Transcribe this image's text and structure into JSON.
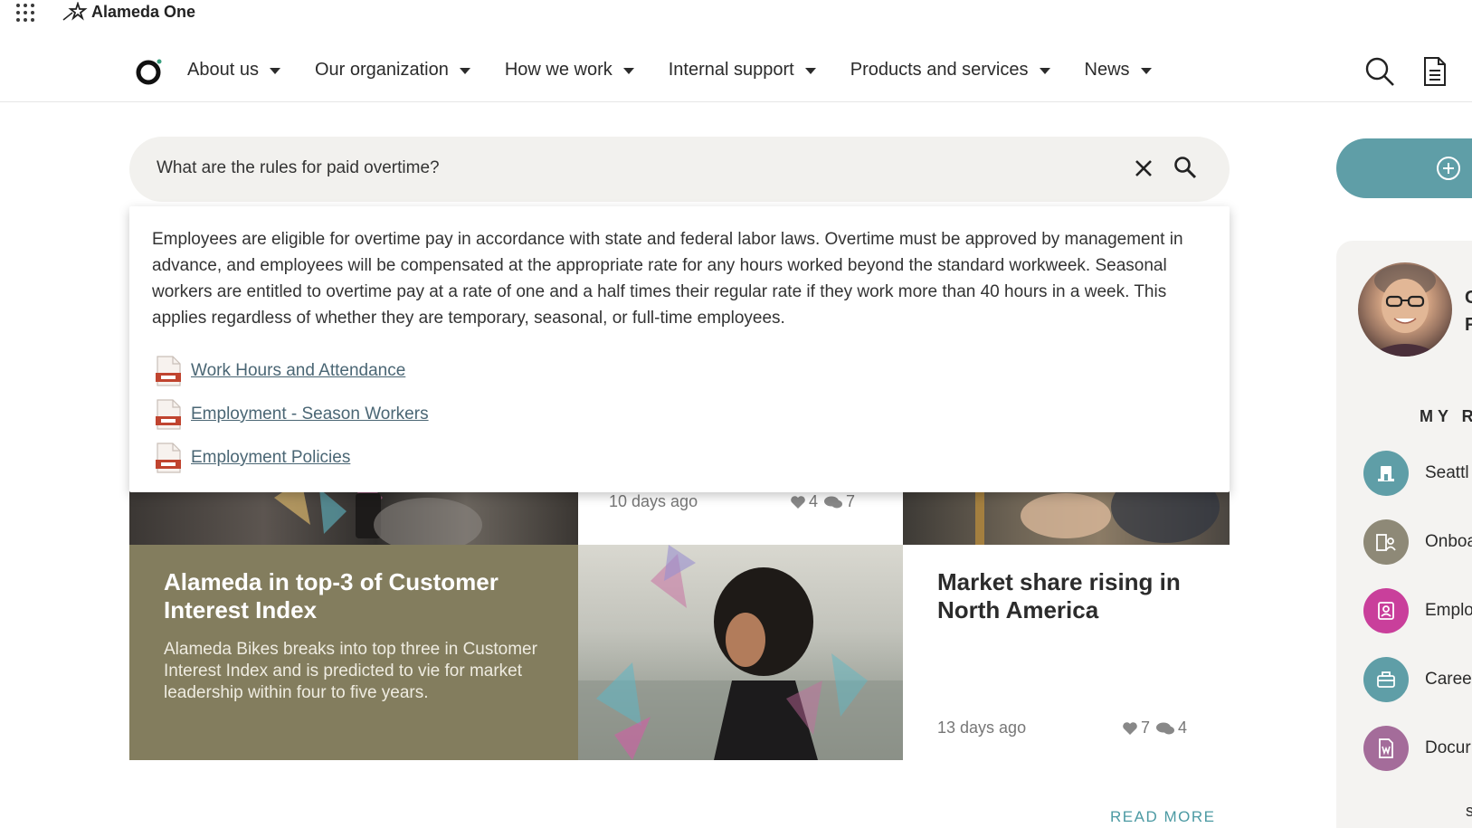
{
  "app": {
    "name": "Alameda One"
  },
  "nav": {
    "items": [
      {
        "label": "About us"
      },
      {
        "label": "Our organization"
      },
      {
        "label": "How we work"
      },
      {
        "label": "Internal support"
      },
      {
        "label": "Products and services"
      },
      {
        "label": "News"
      }
    ]
  },
  "search": {
    "query": "What are the rules for paid overtime?"
  },
  "answer": {
    "text": "Employees are eligible for overtime pay in accordance with state and federal labor laws. Overtime must be approved by management in advance, and employees will be compensated at the appropriate rate for any hours worked beyond the standard workweek. Seasonal workers are entitled to overtime pay at a rate of one and a half times their regular rate if they work more than 40 hours in a week. This applies regardless of whether they are temporary, seasonal, or full-time employees.",
    "sources": [
      {
        "label": "Work Hours and Attendance"
      },
      {
        "label": "Employment - Season Workers"
      },
      {
        "label": "Employment Policies"
      }
    ]
  },
  "news": {
    "top_meta": {
      "time": "10 days ago",
      "likes": "4",
      "comments": "7"
    },
    "olive_card": {
      "title": "Alameda in top-3 of Customer Interest Index",
      "body": "Alameda Bikes breaks into top three in Customer Interest Index and is predicted to vie for market leadership within four to five years."
    },
    "white_card": {
      "title": "Market share rising in North America",
      "time": "13 days ago",
      "likes": "7",
      "comments": "4"
    },
    "read_more": "READ MORE"
  },
  "sidebar": {
    "initial_line1": "C",
    "initial_line2": "F",
    "heading": "MY R",
    "items": [
      {
        "label": "Seattl",
        "color": "#5f9ea7"
      },
      {
        "label": "Onboa",
        "color": "#8e8977"
      },
      {
        "label": "Emplo",
        "color": "#c93f9b"
      },
      {
        "label": "Caree",
        "color": "#5f9ea7"
      },
      {
        "label": "Docur",
        "color": "#a46c9a"
      }
    ],
    "more": "s"
  },
  "colors": {
    "accent_teal": "#5f9ea7",
    "olive": "#837d5e",
    "link": "#4a6674"
  }
}
